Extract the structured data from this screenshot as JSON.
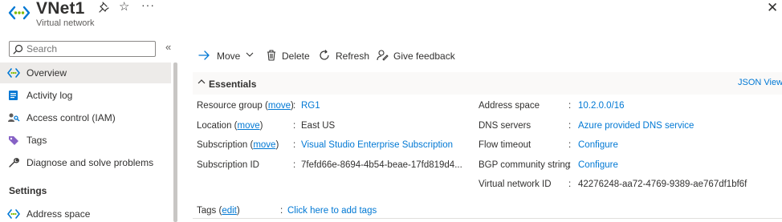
{
  "header": {
    "title": "VNet1",
    "subtitle": "Virtual network"
  },
  "sidebar": {
    "search_placeholder": "Search",
    "items": [
      {
        "label": "Overview",
        "icon": "vnet-icon"
      },
      {
        "label": "Activity log",
        "icon": "activity-log-icon"
      },
      {
        "label": "Access control (IAM)",
        "icon": "iam-icon"
      },
      {
        "label": "Tags",
        "icon": "tag-icon"
      },
      {
        "label": "Diagnose and solve problems",
        "icon": "wrench-icon"
      }
    ],
    "section_settings": "Settings",
    "settings_items": [
      {
        "label": "Address space",
        "icon": "vnet-icon"
      }
    ]
  },
  "toolbar": {
    "move": "Move",
    "delete": "Delete",
    "refresh": "Refresh",
    "feedback": "Give feedback"
  },
  "essentials": {
    "title": "Essentials",
    "json_view": "JSON View",
    "left": {
      "resource_group": {
        "label": "Resource group",
        "move": "move",
        "value": "RG1"
      },
      "location": {
        "label": "Location",
        "move": "move",
        "value": "East US"
      },
      "subscription": {
        "label": "Subscription",
        "move": "move",
        "value": "Visual Studio Enterprise Subscription"
      },
      "subscription_id": {
        "label": "Subscription ID",
        "value": "7fefd66e-8694-4b54-beae-17fd819d4..."
      }
    },
    "right": {
      "address_space": {
        "label": "Address space",
        "value": "10.2.0.0/16"
      },
      "dns_servers": {
        "label": "DNS servers",
        "value": "Azure provided DNS service"
      },
      "flow_timeout": {
        "label": "Flow timeout",
        "value": "Configure"
      },
      "bgp": {
        "label": "BGP community string",
        "value": "Configure"
      },
      "vnet_id": {
        "label": "Virtual network ID",
        "value": "42276248-aa72-4769-9389-ae767df1bf6f"
      }
    },
    "tags": {
      "label": "Tags",
      "edit": "edit",
      "value": "Click here to add tags"
    }
  },
  "colors": {
    "link": "#0078d4",
    "active_bg": "#edebe9",
    "vnet_icon": "#0078d4"
  }
}
